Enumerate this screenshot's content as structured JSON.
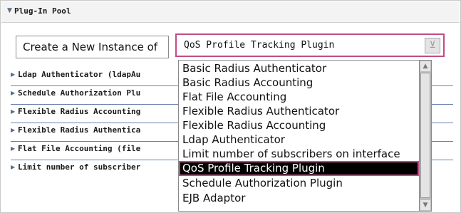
{
  "pool": {
    "title": "Plug-In Pool"
  },
  "create": {
    "label": "Create a New Instance of",
    "selected": "QoS Profile Tracking Plugin"
  },
  "rows": [
    {
      "label": "Ldap Authenticator (ldapAu"
    },
    {
      "label": "Schedule Authorization Plu"
    },
    {
      "label": "Flexible Radius Accounting"
    },
    {
      "label": "Flexible Radius Authentica"
    },
    {
      "label": "Flat File Accounting (file"
    },
    {
      "label": "Limit number of subscriber"
    }
  ],
  "dropdown": {
    "options": [
      "Basic Radius Authenticator",
      "Basic Radius Accounting",
      "Flat File Accounting",
      "Flexible Radius Authenticator",
      "Flexible Radius Accounting",
      "Ldap Authenticator",
      "Limit number of subscribers on interface",
      "QoS Profile Tracking Plugin",
      "Schedule Authorization Plugin",
      "EJB Adaptor"
    ],
    "selected_index": 7
  },
  "colors": {
    "accent": "#c24c86",
    "row_rule": "#6a7fb0",
    "selection_bg": "#000000"
  }
}
